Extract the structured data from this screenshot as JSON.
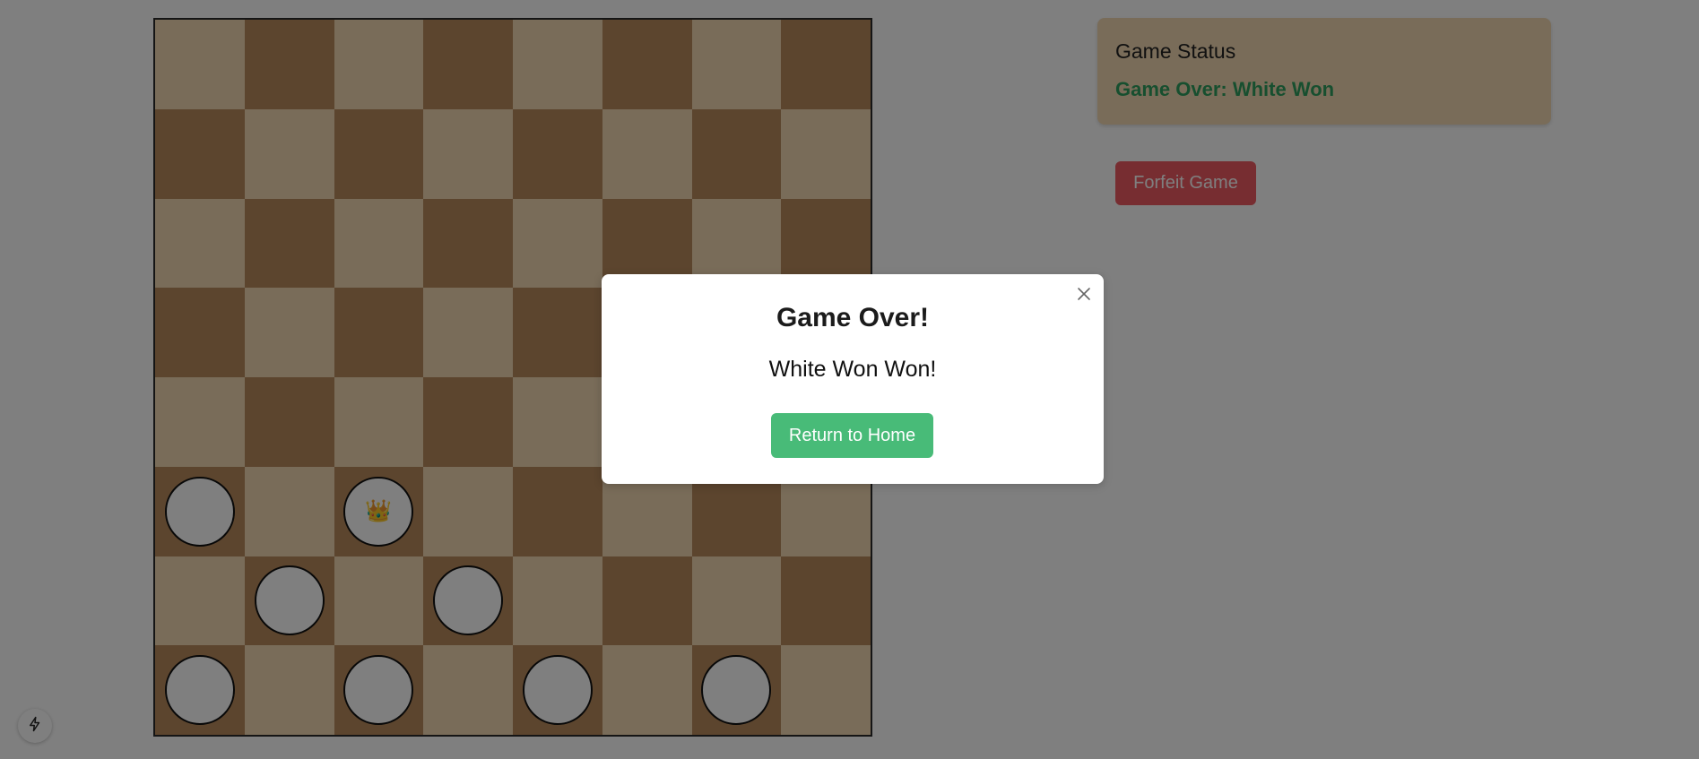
{
  "board": {
    "rows": 8,
    "columns": 8,
    "colors": {
      "light_square": "#f2d9b3",
      "dark_square": "#b88a5c",
      "piece_fill": "#ffffff",
      "piece_border": "#111111"
    },
    "pieces": [
      {
        "row": 5,
        "col": 0,
        "type": "man"
      },
      {
        "row": 5,
        "col": 2,
        "type": "king",
        "icon": "crown-icon"
      },
      {
        "row": 6,
        "col": 1,
        "type": "man"
      },
      {
        "row": 6,
        "col": 3,
        "type": "man"
      },
      {
        "row": 7,
        "col": 0,
        "type": "man"
      },
      {
        "row": 7,
        "col": 2,
        "type": "man"
      },
      {
        "row": 7,
        "col": 4,
        "type": "man"
      },
      {
        "row": 7,
        "col": 6,
        "type": "man"
      }
    ]
  },
  "status": {
    "title": "Game Status",
    "value": "Game Over: White Won"
  },
  "controls": {
    "forfeit_label": "Forfeit Game"
  },
  "modal": {
    "title": "Game Over!",
    "message": "White Won Won!",
    "return_home_label": "Return to Home",
    "close_icon": "close-icon"
  },
  "dev_tools": {
    "icon": "lightning-icon"
  },
  "colors": {
    "status_success": "#2f9e5f",
    "danger": "#ef5b63",
    "primary": "#48bb78",
    "overlay": "rgba(0, 0, 0, 0.5)"
  }
}
